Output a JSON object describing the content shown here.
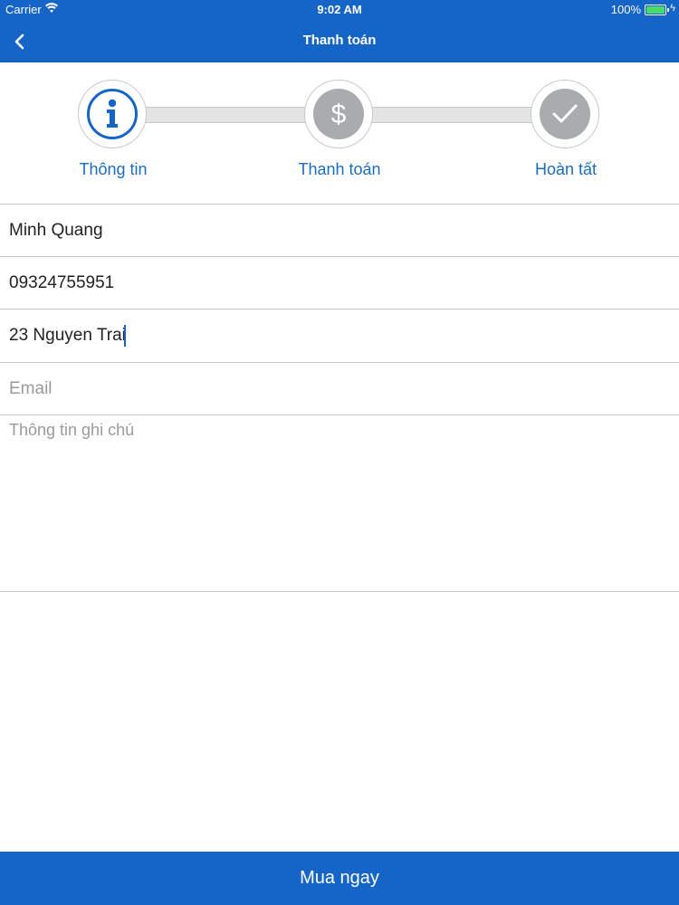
{
  "status_bar": {
    "carrier": "Carrier",
    "time": "9:02 AM",
    "battery_percent": "100%",
    "battery_color": "#4cd964"
  },
  "header": {
    "title": "Thanh toán",
    "back_icon": "chevron-left-icon",
    "background": "#1565c8"
  },
  "steps": [
    {
      "label": "Thông tin",
      "icon": "info-icon",
      "active": true
    },
    {
      "label": "Thanh toán",
      "icon": "dollar-icon",
      "active": false
    },
    {
      "label": "Hoàn tất",
      "icon": "check-icon",
      "active": false
    }
  ],
  "form": {
    "name_value": "Minh Quang",
    "phone_value": "09324755951",
    "address_value": "23 Nguyen Trai",
    "email_value": "",
    "email_placeholder": "Email",
    "note_placeholder": "Thông tin ghi chú"
  },
  "buy_button": {
    "label": "Mua ngay"
  },
  "colors": {
    "accent": "#1565c8",
    "step_label": "#1a6dbf",
    "inactive_step": "#a9abae"
  }
}
